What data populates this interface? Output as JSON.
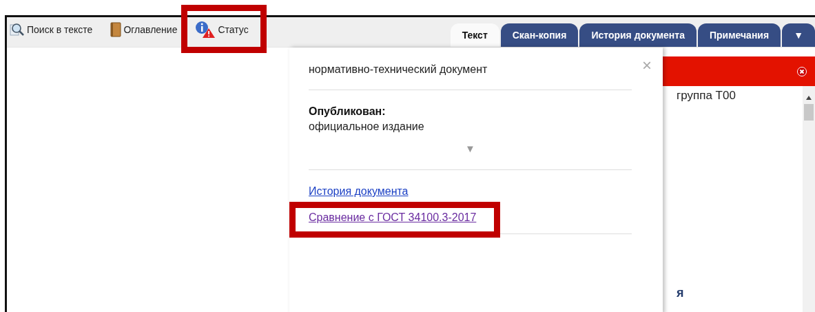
{
  "toolbar": {
    "items": [
      {
        "kind": "search",
        "label": "Поиск в тексте",
        "highlighted": false
      },
      {
        "kind": "contents",
        "label": "Оглавление",
        "highlighted": false
      },
      {
        "kind": "status",
        "label": "Статус",
        "highlighted": true
      }
    ]
  },
  "tabs": [
    {
      "label": "Текст",
      "selected": true
    },
    {
      "label": "Скан-копия",
      "selected": false
    },
    {
      "label": "История документа",
      "selected": false
    },
    {
      "label": "Примечания",
      "selected": false
    },
    {
      "label": "▼",
      "selected": false
    }
  ],
  "popup": {
    "close": "×",
    "heading": "нормативно-технический документ",
    "field_label": "Опубликован:",
    "field_value": "официальное издание",
    "expander": "▼",
    "links": [
      {
        "label": "История документа",
        "visited": false,
        "highlighted": false
      },
      {
        "label": "Сравнение с ГОСТ 34100.3-2017",
        "visited": true,
        "highlighted": true
      }
    ]
  },
  "side_panel": {
    "text": "группа Т00",
    "fragment": "я"
  }
}
